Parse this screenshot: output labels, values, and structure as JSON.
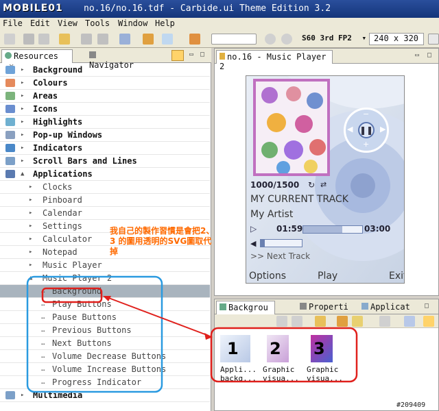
{
  "window": {
    "logo": "MOBILE01",
    "title": "no.16/no.16.tdf - Carbide.ui Theme Edition 3.2"
  },
  "menu": [
    "File",
    "Edit",
    "View",
    "Tools",
    "Window",
    "Help"
  ],
  "toolbar": {
    "device": "S60 3rd FP2",
    "device_arrow": "▾",
    "resolution": "240 x 320"
  },
  "left_tabs": {
    "resources": "Resources",
    "navigator": "Navigator"
  },
  "resources": [
    {
      "label": "Background",
      "level": 0,
      "expanded": false
    },
    {
      "label": "Colours",
      "level": 0,
      "expanded": false
    },
    {
      "label": "Areas",
      "level": 0,
      "expanded": false
    },
    {
      "label": "Icons",
      "level": 0,
      "expanded": false
    },
    {
      "label": "Highlights",
      "level": 0,
      "expanded": false
    },
    {
      "label": "Pop-up Windows",
      "level": 0,
      "expanded": false
    },
    {
      "label": "Indicators",
      "level": 0,
      "expanded": false
    },
    {
      "label": "Scroll Bars and Lines",
      "level": 0,
      "expanded": false
    },
    {
      "label": "Applications",
      "level": 0,
      "expanded": true
    },
    {
      "label": "Clocks",
      "level": 1,
      "expanded": false
    },
    {
      "label": "Pinboard",
      "level": 1,
      "expanded": false
    },
    {
      "label": "Calendar",
      "level": 1,
      "expanded": false
    },
    {
      "label": "Settings",
      "level": 1,
      "expanded": false
    },
    {
      "label": "Calculator",
      "level": 1,
      "expanded": false
    },
    {
      "label": "Notepad",
      "level": 1,
      "expanded": false
    },
    {
      "label": "Music Player",
      "level": 1,
      "expanded": false
    },
    {
      "label": "Music Player 2",
      "level": 1,
      "expanded": true
    },
    {
      "label": "Background",
      "level": 2,
      "selected": true
    },
    {
      "label": "Play Buttons",
      "level": 2
    },
    {
      "label": "Pause Buttons",
      "level": 2
    },
    {
      "label": "Previous Buttons",
      "level": 2
    },
    {
      "label": "Next Buttons",
      "level": 2
    },
    {
      "label": "Volume Decrease Buttons",
      "level": 2
    },
    {
      "label": "Volume Increase Buttons",
      "level": 2
    },
    {
      "label": "Progress Indicator",
      "level": 2
    },
    {
      "label": "Multimedia",
      "level": 0,
      "expanded": false
    }
  ],
  "preview_tab": "no.16 - Music Player 2",
  "phone": {
    "counter": "1000/1500",
    "track": "MY CURRENT TRACK",
    "artist": "My Artist",
    "time_elapsed": "01:59",
    "time_total": "03:00",
    "next": ">> Next Track",
    "soft_left": "Options",
    "soft_middle": "Play",
    "soft_right": "Exit"
  },
  "bottom_tabs": {
    "tab1": "Backgrou",
    "tab2": "Properti",
    "tab3": "Applicat"
  },
  "thumbnails": [
    {
      "num": "1",
      "label1": "Appli...",
      "label2": "backg..."
    },
    {
      "num": "2",
      "label1": "Graphic",
      "label2": "visua..."
    },
    {
      "num": "3",
      "label1": "Graphic",
      "label2": "visua..."
    }
  ],
  "annotation": "我自己的製作習慣是會把2、3 的圖用透明的SVG圖取代掉",
  "watermark": "#209409",
  "colors": {
    "title_bar": "#14357a",
    "annotation": "#ff6a00",
    "highlight_red": "#e0201c",
    "highlight_blue": "#2a9ae0",
    "selected_row": "#a9b4be"
  }
}
